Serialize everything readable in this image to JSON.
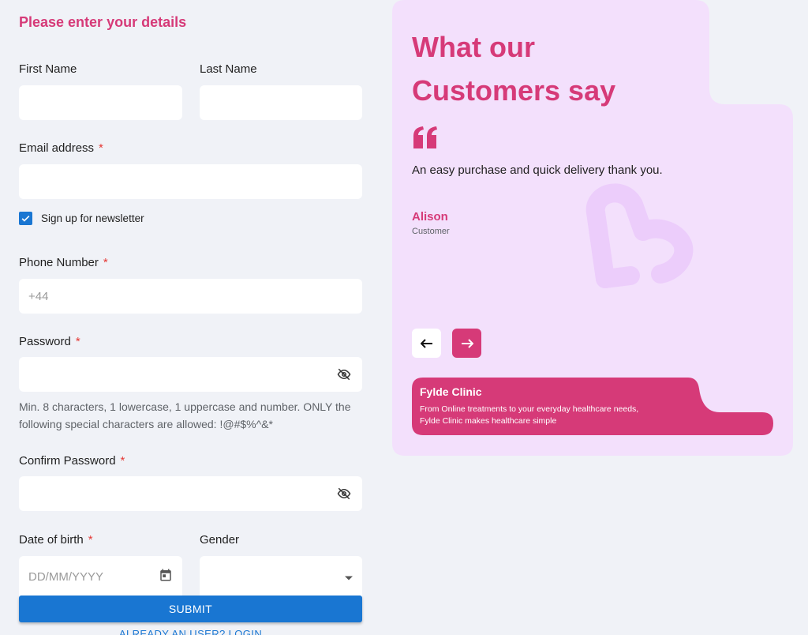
{
  "form": {
    "title": "Please enter your details",
    "first_name_label": "First Name",
    "last_name_label": "Last Name",
    "email_label": "Email address",
    "required_mark": "*",
    "newsletter_label": "Sign up for newsletter",
    "newsletter_checked": true,
    "phone_label": "Phone Number",
    "phone_value": "+44",
    "password_label": "Password",
    "password_hint": "Min. 8 characters, 1 lowercase, 1 uppercase and number. ONLY the following special characters are allowed: !@#$%^&*",
    "confirm_password_label": "Confirm Password",
    "dob_label": "Date of birth",
    "dob_placeholder": "DD/MM/YYYY",
    "gender_label": "Gender",
    "submit_label": "SUBMIT",
    "login_link": "ALREADY AN USER? LOGIN"
  },
  "panel": {
    "heading_line1": "What our",
    "heading_line2": "Customers say",
    "testimonial": "An easy purchase and quick delivery thank you.",
    "author": "Alison",
    "role": "Customer",
    "clinic_name": "Fylde Clinic",
    "clinic_desc_line1": "From Online treatments to your everyday healthcare needs,",
    "clinic_desc_line2": "Fylde Clinic makes healthcare simple"
  },
  "colors": {
    "accent": "#d63a78",
    "primary": "#1976d2",
    "panel_bg": "#f3e0fc",
    "page_bg": "#f0f2f7"
  },
  "icons": [
    "eye-off-icon",
    "calendar-icon",
    "dropdown-arrow-icon",
    "checkbox-checked-icon",
    "quote-icon",
    "arrow-left-icon",
    "arrow-right-icon",
    "heart-logo-icon"
  ]
}
